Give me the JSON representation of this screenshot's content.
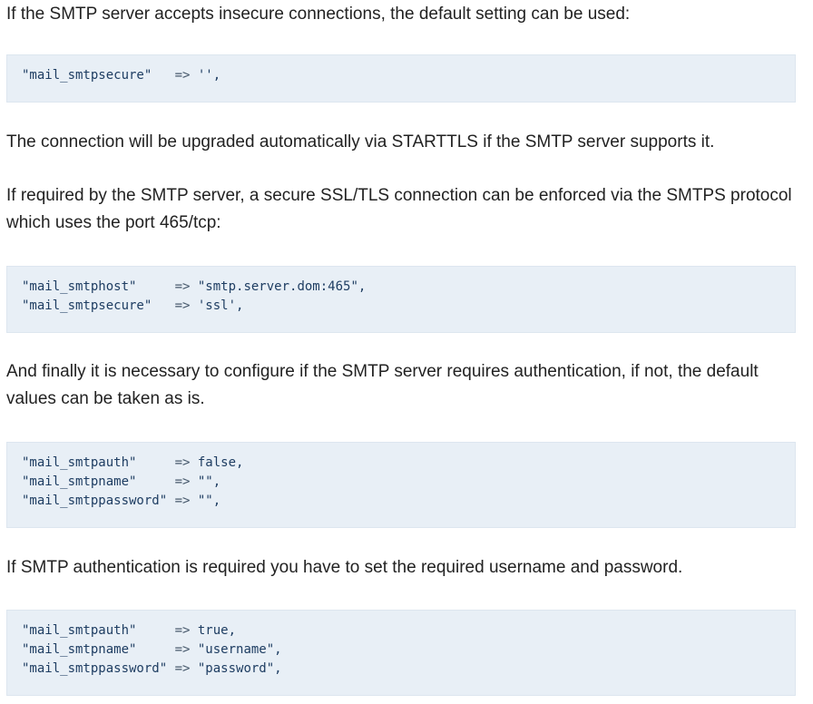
{
  "paragraphs": {
    "p1": "If the SMTP server accepts insecure connections, the default setting can be used:",
    "p2": "The connection will be upgraded automatically via STARTTLS if the SMTP server supports it.",
    "p3": "If required by the SMTP server, a secure SSL/TLS connection can be enforced via the SMTPS protocol which uses the port 465/tcp:",
    "p4": "And finally it is necessary to configure if the SMTP server requires authentication, if not, the default values can be taken as is.",
    "p5": "If SMTP authentication is required you have to set the required username and password."
  },
  "code_blocks": {
    "block1": [
      {
        "key": "\"mail_smtpsecure\"  ",
        "op": " => ",
        "value": "'',"
      }
    ],
    "block2": [
      {
        "key": "\"mail_smtphost\"    ",
        "op": " => ",
        "value": "\"smtp.server.dom:465\","
      },
      {
        "key": "\"mail_smtpsecure\"  ",
        "op": " => ",
        "value": "'ssl',"
      }
    ],
    "block3": [
      {
        "key": "\"mail_smtpauth\"    ",
        "op": " => ",
        "value": "false,"
      },
      {
        "key": "\"mail_smtpname\"    ",
        "op": " => ",
        "value": "\"\","
      },
      {
        "key": "\"mail_smtppassword\"",
        "op": " => ",
        "value": "\"\","
      }
    ],
    "block4": [
      {
        "key": "\"mail_smtpauth\"    ",
        "op": " => ",
        "value": "true,"
      },
      {
        "key": "\"mail_smtpname\"    ",
        "op": " => ",
        "value": "\"username\","
      },
      {
        "key": "\"mail_smtppassword\"",
        "op": " => ",
        "value": "\"password\","
      }
    ]
  }
}
